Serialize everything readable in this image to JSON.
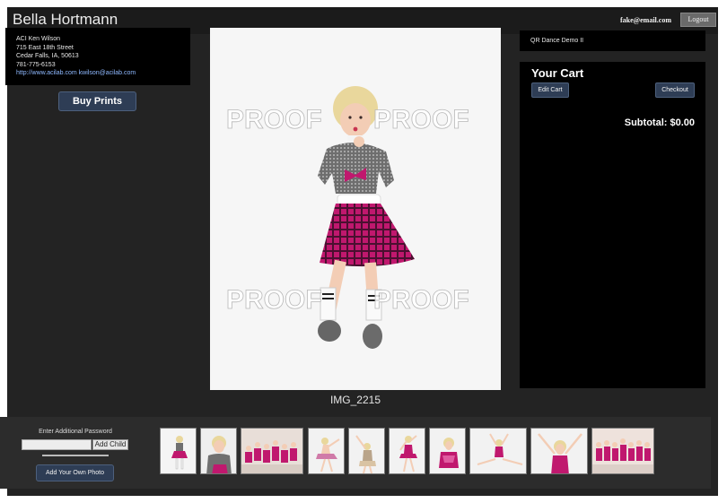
{
  "header": {
    "title": "Bella Hortmann",
    "email": "fake@email.com",
    "logout_label": "Logout"
  },
  "lab_info": {
    "name": "ACI Ken Wilson",
    "street": "715 East 18th Street",
    "city": "Cedar Falls, IA, 50613",
    "phone": "781-775-6153",
    "web": "http://www.acilab.com",
    "email": "kwilson@acilab.com"
  },
  "buy_prints_label": "Buy Prints",
  "photo": {
    "watermark": "PROOF",
    "caption": "IMG_2215"
  },
  "event_name": "QR Dance Demo II",
  "cart": {
    "title": "Your Cart",
    "edit_label": "Edit Cart",
    "checkout_label": "Checkout",
    "subtotal": "Subtotal: $0.00"
  },
  "footer": {
    "password_label": "Enter Additional Password",
    "add_child_label": "Add Child",
    "add_photo_label": "Add Your Own Photo"
  },
  "colors": {
    "costume_pink": "#c0186e",
    "costume_dark": "#4a1030",
    "button_blue": "#2e3d55"
  },
  "thumbnails": [
    {
      "kind": "single"
    },
    {
      "kind": "single"
    },
    {
      "kind": "group"
    },
    {
      "kind": "single"
    },
    {
      "kind": "single"
    },
    {
      "kind": "single"
    },
    {
      "kind": "single"
    },
    {
      "kind": "wide"
    },
    {
      "kind": "wide"
    },
    {
      "kind": "group"
    }
  ]
}
